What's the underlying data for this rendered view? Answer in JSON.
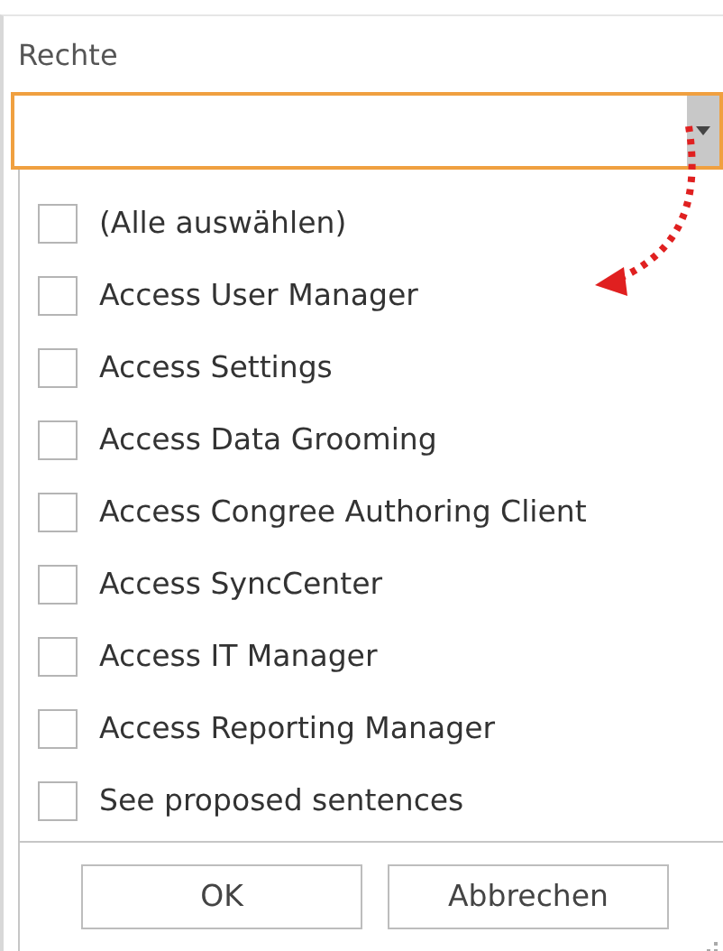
{
  "field_label": "Rechte",
  "combo": {
    "expanded": true
  },
  "items": [
    {
      "label": "(Alle auswählen)",
      "checked": false
    },
    {
      "label": "Access User Manager",
      "checked": false
    },
    {
      "label": "Access Settings",
      "checked": false
    },
    {
      "label": "Access Data Grooming",
      "checked": false
    },
    {
      "label": "Access Congree Authoring Client",
      "checked": false
    },
    {
      "label": "Access SyncCenter",
      "checked": false
    },
    {
      "label": "Access IT Manager",
      "checked": false
    },
    {
      "label": "Access Reporting Manager",
      "checked": false
    },
    {
      "label": "See proposed sentences",
      "checked": false
    }
  ],
  "buttons": [
    "OK",
    "Abbrechen"
  ]
}
